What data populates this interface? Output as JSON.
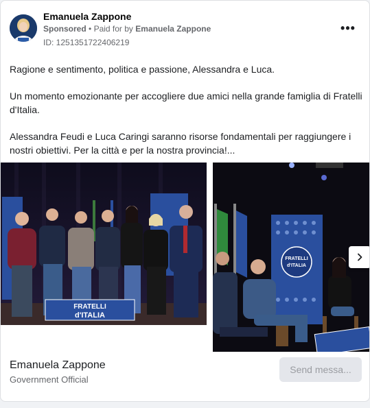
{
  "ad": {
    "page_name": "Emanuela Zappone",
    "sponsored_label": "Sponsored",
    "paid_for_prefix": "Paid for by",
    "paid_for_by": "Emanuela Zappone",
    "id_text": "ID: 1251351722406219",
    "more_icon": "more-horizontal-icon",
    "more_glyph": "•••"
  },
  "post": {
    "paragraphs": [
      "Ragione e sentimento, politica e passione, Alessandra e Luca.",
      "Un momento emozionante per accogliere due amici nella grande famiglia di Fratelli d'Italia.",
      "Alessandra Feudi e Luca Caringi saranno risorse fondamentali per raggiungere i nostri obiettivi. Per la città e per la nostra provincia!..."
    ]
  },
  "carousel": {
    "banner_text_1": "FRATELLI",
    "banner_text_2": "d'ITALIA",
    "panel_text_1": "FRATELLI",
    "panel_text_2": "d'ITALIA",
    "next_icon": "chevron-right-icon"
  },
  "footer": {
    "name": "Emanuela Zappone",
    "category": "Government Official",
    "button_label": "Send messa..."
  },
  "colors": {
    "brand_blue": "#1a3a8a",
    "muted_text": "#65676b",
    "button_bg": "#e4e6eb"
  }
}
